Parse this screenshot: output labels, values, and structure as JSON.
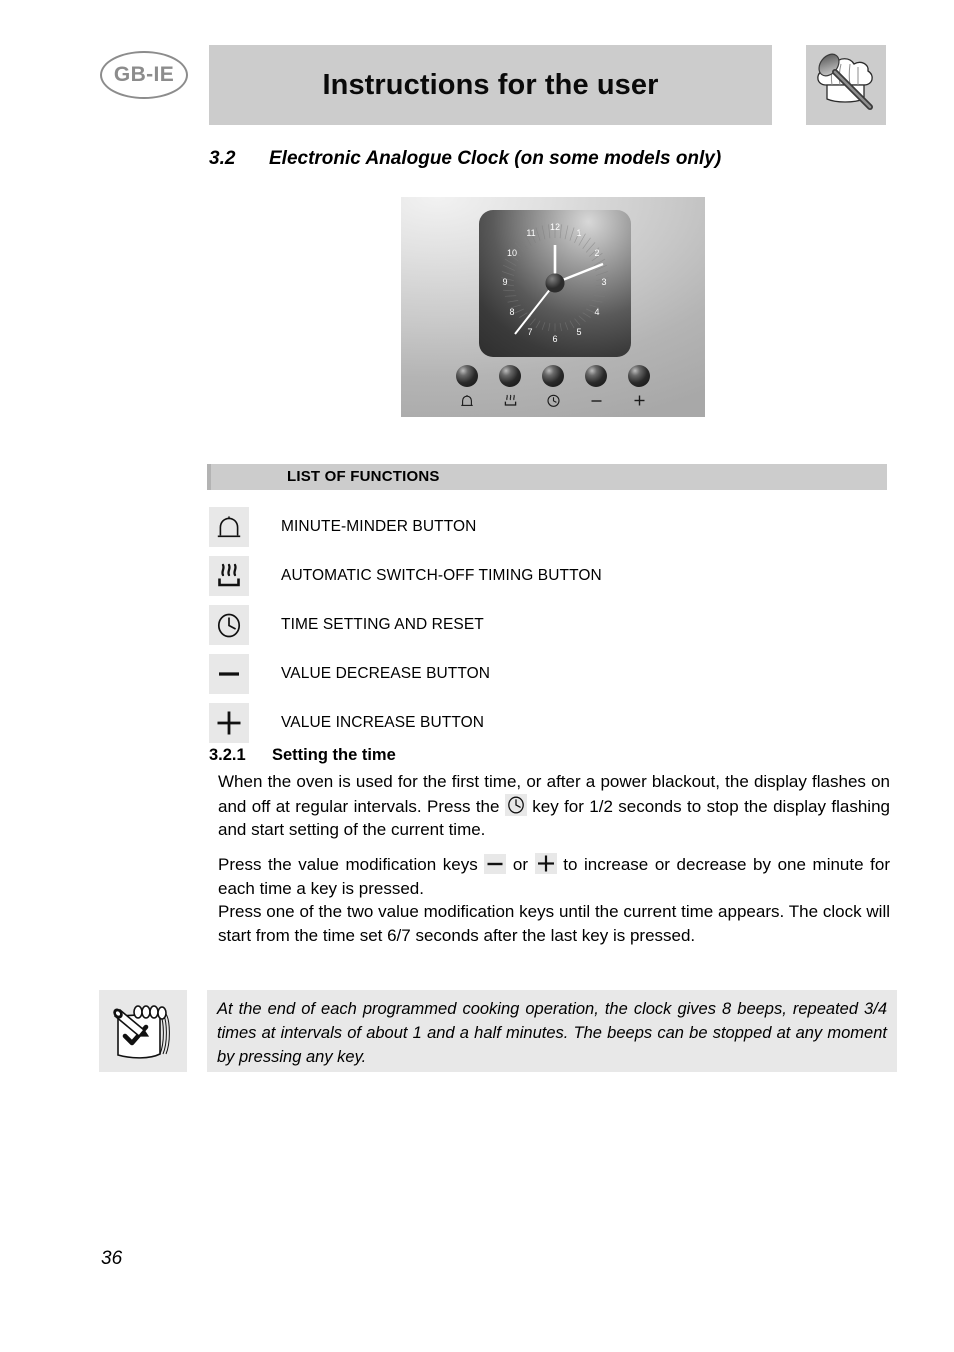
{
  "header": {
    "country_badge": "GB-IE",
    "title": "Instructions for the user",
    "logo_icon": "chef-hat-spoon-icon"
  },
  "section": {
    "number": "3.2",
    "title": "Electronic Analogue Clock (on some models only)"
  },
  "clock_photo": {
    "caption_icons": [
      "bell-icon",
      "heating-element-icon",
      "clock-icon",
      "minus-icon",
      "plus-icon"
    ],
    "face_numbers": [
      "12",
      "1",
      "2",
      "3",
      "4",
      "5",
      "6",
      "7",
      "8",
      "9",
      "10",
      "11"
    ],
    "hands": {
      "hour": "12",
      "minute": "2:30",
      "second": "7"
    }
  },
  "functions": {
    "bar_label": "LIST OF FUNCTIONS",
    "items": [
      {
        "icon": "bell-icon",
        "label": "MINUTE-MINDER BUTTON"
      },
      {
        "icon": "heating-element-icon",
        "label": "AUTOMATIC SWITCH-OFF TIMING BUTTON"
      },
      {
        "icon": "clock-icon",
        "label": "TIME SETTING AND RESET"
      },
      {
        "icon": "minus-icon",
        "label": "VALUE DECREASE BUTTON"
      },
      {
        "icon": "plus-icon",
        "label": "VALUE INCREASE BUTTON"
      }
    ]
  },
  "subsection": {
    "number": "3.2.1",
    "title": "Setting the time",
    "paragraph1_a": "When the oven is used for the first time, or after a power blackout, the display flashes on and off at regular intervals.  Press the",
    "paragraph1_b": "key for 1/2 seconds to stop the display flashing and start setting of the current time.",
    "paragraph2_a": "Press the value modification keys",
    "paragraph2_b": "or",
    "paragraph2_c": "to increase or decrease by one minute for each time a key is pressed.",
    "paragraph3": "Press one of the two value modification keys until the current time appears. The clock will start from the time set 6/7 seconds after the last key is pressed."
  },
  "note": {
    "icon": "notepad-pencil-icon",
    "text": "At the end of each programmed cooking operation, the clock gives 8 beeps, repeated 3/4 times at intervals of about 1 and a half minutes. The beeps can be stopped at any moment by pressing any key."
  },
  "footer": {
    "page_number": "36"
  },
  "colors": {
    "header_bar": "#cccccc",
    "icon_tile": "#e8e8e8",
    "badge_gray": "#8c8c8c",
    "text": "#000000"
  }
}
